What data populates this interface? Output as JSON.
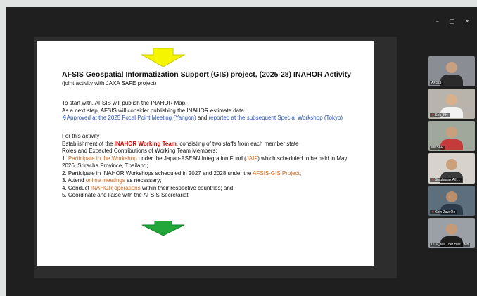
{
  "window": {
    "controls": {
      "minimize": "–",
      "restore": "▢",
      "close": "×"
    }
  },
  "slide": {
    "title": "AFSIS Geospatial Informatization Support (GIS) project, (2025-28) INAHOR Activity",
    "subtitle": "(joint activity with JAXA SAFE project)",
    "p1": {
      "line1": "To start with, AFSIS will publish the INAHOR Map.",
      "line2": "As a next step, AFSIS will consider publishing the INAHOR estimate data.",
      "line3_a": "※Approved at the 2025 Focal Point Meeting (Yangon)",
      "line3_b": " and ",
      "line3_c": "reported at the subsequent Special Workshop (Tokyo)"
    },
    "p2": {
      "heading": "For this activity",
      "est_a": "Establishment of the ",
      "est_b": "INAHOR Working Team",
      "est_c": ", consisting of two staffs from each member state",
      "roles": "Roles and Expected Contributions of Working Team Members:",
      "i1_a": "1. ",
      "i1_b": "Participate in the Workshop",
      "i1_c": " under the Japan-ASEAN Integration Fund (",
      "i1_d": "JAIF",
      "i1_e": ") which scheduled to be held in May",
      "i1_f": "2026, Sriracha Province, Thailand;",
      "i2_a": "2. Participate in INAHOR Workshops scheduled in 2027 and 2028 under the ",
      "i2_b": "AFSIS-GIS Project",
      "i2_c": ";",
      "i3_a": "3. Attend ",
      "i3_b": "online meetings",
      "i3_c": " as necessary;",
      "i4_a": "4. Conduct ",
      "i4_b": "INAHOR operations",
      "i4_c": " within their respective countries; and",
      "i5": "5. Coordinate and liaise with the AFSIS Secretariat"
    }
  },
  "participants": [
    {
      "name": "AFSIS",
      "muted": false,
      "active": false,
      "bg": "#8a8d93",
      "skin": "#c9a07f",
      "shirt": "#2b2b2b"
    },
    {
      "name": "Sok_KH",
      "muted": true,
      "active": false,
      "bg": "#b9b4ab",
      "skin": "#d8b08c",
      "shirt": "#f2f2f2"
    },
    {
      "name": "MPSFR",
      "muted": false,
      "active": true,
      "bg": "#9fa89a",
      "skin": "#c8a07e",
      "shirt": "#c53b3b"
    },
    {
      "name": "Singhasak Ath...",
      "muted": true,
      "active": false,
      "bg": "#d7d2cb",
      "skin": "#caa17c",
      "shirt": "#3a3a3a"
    },
    {
      "name": "Khin Zaw Oo",
      "muted": true,
      "active": false,
      "bg": "#5d6f7d",
      "skin": "#b98e6c",
      "shirt": "#2e3b4a"
    },
    {
      "name": "DTV_Ma Thet Htet Lwin",
      "muted": false,
      "active": false,
      "bg": "#9aa0a6",
      "skin": "#c49a78",
      "shirt": "#1e1e1e"
    }
  ]
}
